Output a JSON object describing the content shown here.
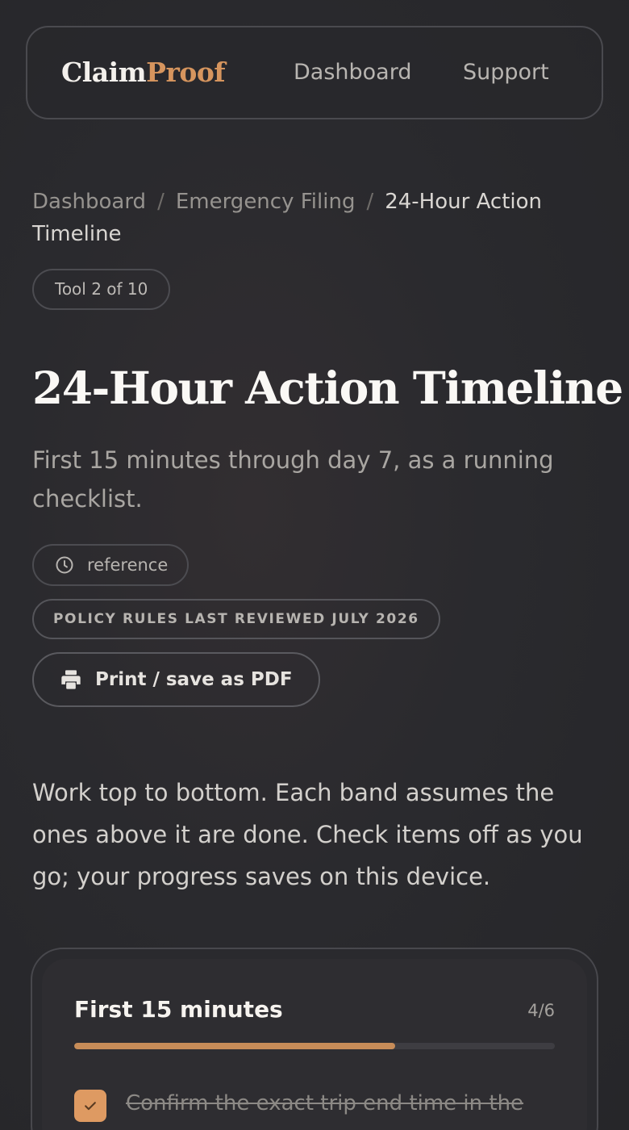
{
  "nav": {
    "brand_a": "Claim",
    "brand_b": "Proof",
    "links": [
      "Dashboard",
      "Support"
    ]
  },
  "breadcrumb": {
    "items": [
      "Dashboard",
      "Emergency Filing",
      "24-Hour Action Timeline"
    ]
  },
  "tool_pill": "Tool 2 of 10",
  "page": {
    "title": "24-Hour Action Timeline",
    "subtitle": "First 15 minutes through day 7, as a running checklist.",
    "type_tag": "reference",
    "review_badge": "POLICY RULES LAST REVIEWED JULY 2026",
    "print_label": "Print / save as PDF",
    "intro": "Work top to bottom. Each band assumes the ones above it are done. Check items off as you go; your progress saves on this device."
  },
  "band": {
    "title": "First 15 minutes",
    "count": "4/6",
    "progress": 0.667,
    "first_item": "Confirm the exact trip end time in the"
  },
  "colors": {
    "accent": "#d6955e",
    "progress_fill": "#c78c58",
    "checkbox": "#de9a62"
  },
  "icons": {
    "tag": "clock-icon",
    "print": "printer-icon",
    "check": "check-icon"
  }
}
